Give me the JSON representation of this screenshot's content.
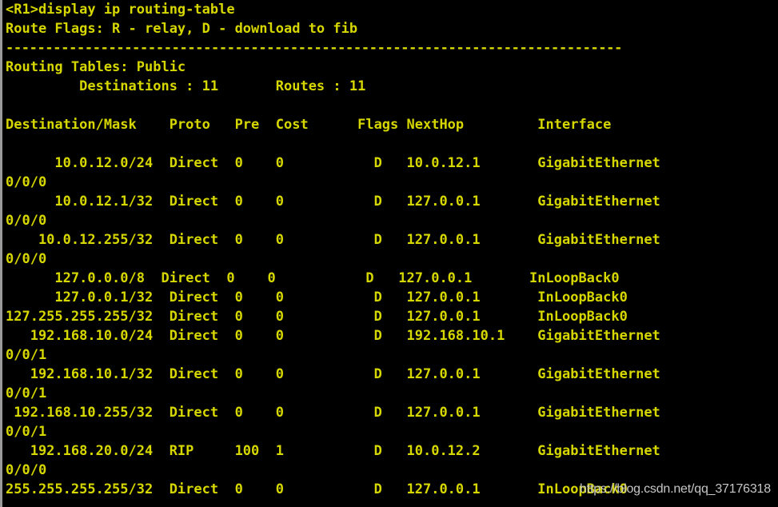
{
  "terminal": {
    "prompt_line": "<R1>display ip routing-table",
    "route_flags_line": "Route Flags: R - relay, D - download to fib",
    "separator": "------------------------------------------------------------------------------",
    "routing_tables_line": "Routing Tables: Public",
    "summary_line": "         Destinations : 11       Routes : 11",
    "colors": {
      "foreground": "#d7d700",
      "background": "#000000",
      "border": "#9a9a9a",
      "watermark": "#d8d8d8"
    }
  },
  "table": {
    "header_line": "Destination/Mask    Proto   Pre  Cost      Flags NextHop         Interface",
    "headers": [
      "Destination/Mask",
      "Proto",
      "Pre",
      "Cost",
      "Flags",
      "NextHop",
      "Interface"
    ],
    "rows": [
      {
        "line1": "      10.0.12.0/24  Direct  0    0           D   10.0.12.1       GigabitEthernet",
        "line2": "0/0/0",
        "destination_mask": "10.0.12.0/24",
        "proto": "Direct",
        "pre": "0",
        "cost": "0",
        "flags": "D",
        "nexthop": "10.0.12.1",
        "interface": "GigabitEthernet0/0/0"
      },
      {
        "line1": "      10.0.12.1/32  Direct  0    0           D   127.0.0.1       GigabitEthernet",
        "line2": "0/0/0",
        "destination_mask": "10.0.12.1/32",
        "proto": "Direct",
        "pre": "0",
        "cost": "0",
        "flags": "D",
        "nexthop": "127.0.0.1",
        "interface": "GigabitEthernet0/0/0"
      },
      {
        "line1": "    10.0.12.255/32  Direct  0    0           D   127.0.0.1       GigabitEthernet",
        "line2": "0/0/0",
        "destination_mask": "10.0.12.255/32",
        "proto": "Direct",
        "pre": "0",
        "cost": "0",
        "flags": "D",
        "nexthop": "127.0.0.1",
        "interface": "GigabitEthernet0/0/0"
      },
      {
        "line1": "      127.0.0.0/8  Direct  0    0           D   127.0.0.1       InLoopBack0",
        "line2": "",
        "destination_mask": "127.0.0.0/8",
        "proto": "Direct",
        "pre": "0",
        "cost": "0",
        "flags": "D",
        "nexthop": "127.0.0.1",
        "interface": "InLoopBack0"
      },
      {
        "line1": "      127.0.0.1/32  Direct  0    0           D   127.0.0.1       InLoopBack0",
        "line2": "",
        "destination_mask": "127.0.0.1/32",
        "proto": "Direct",
        "pre": "0",
        "cost": "0",
        "flags": "D",
        "nexthop": "127.0.0.1",
        "interface": "InLoopBack0"
      },
      {
        "line1": "127.255.255.255/32  Direct  0    0           D   127.0.0.1       InLoopBack0",
        "line2": "",
        "destination_mask": "127.255.255.255/32",
        "proto": "Direct",
        "pre": "0",
        "cost": "0",
        "flags": "D",
        "nexthop": "127.0.0.1",
        "interface": "InLoopBack0"
      },
      {
        "line1": "   192.168.10.0/24  Direct  0    0           D   192.168.10.1    GigabitEthernet",
        "line2": "0/0/1",
        "destination_mask": "192.168.10.0/24",
        "proto": "Direct",
        "pre": "0",
        "cost": "0",
        "flags": "D",
        "nexthop": "192.168.10.1",
        "interface": "GigabitEthernet0/0/1"
      },
      {
        "line1": "   192.168.10.1/32  Direct  0    0           D   127.0.0.1       GigabitEthernet",
        "line2": "0/0/1",
        "destination_mask": "192.168.10.1/32",
        "proto": "Direct",
        "pre": "0",
        "cost": "0",
        "flags": "D",
        "nexthop": "127.0.0.1",
        "interface": "GigabitEthernet0/0/1"
      },
      {
        "line1": " 192.168.10.255/32  Direct  0    0           D   127.0.0.1       GigabitEthernet",
        "line2": "0/0/1",
        "destination_mask": "192.168.10.255/32",
        "proto": "Direct",
        "pre": "0",
        "cost": "0",
        "flags": "D",
        "nexthop": "127.0.0.1",
        "interface": "GigabitEthernet0/0/1"
      },
      {
        "line1": "   192.168.20.0/24  RIP     100  1           D   10.0.12.2       GigabitEthernet",
        "line2": "0/0/0",
        "destination_mask": "192.168.20.0/24",
        "proto": "RIP",
        "pre": "100",
        "cost": "1",
        "flags": "D",
        "nexthop": "10.0.12.2",
        "interface": "GigabitEthernet0/0/0"
      },
      {
        "line1": "255.255.255.255/32  Direct  0    0           D   127.0.0.1       InLoopBack0",
        "line2": "",
        "destination_mask": "255.255.255.255/32",
        "proto": "Direct",
        "pre": "0",
        "cost": "0",
        "flags": "D",
        "nexthop": "127.0.0.1",
        "interface": "InLoopBack0"
      }
    ]
  },
  "watermark": {
    "text": "https://blog.csdn.net/qq_37176318"
  }
}
